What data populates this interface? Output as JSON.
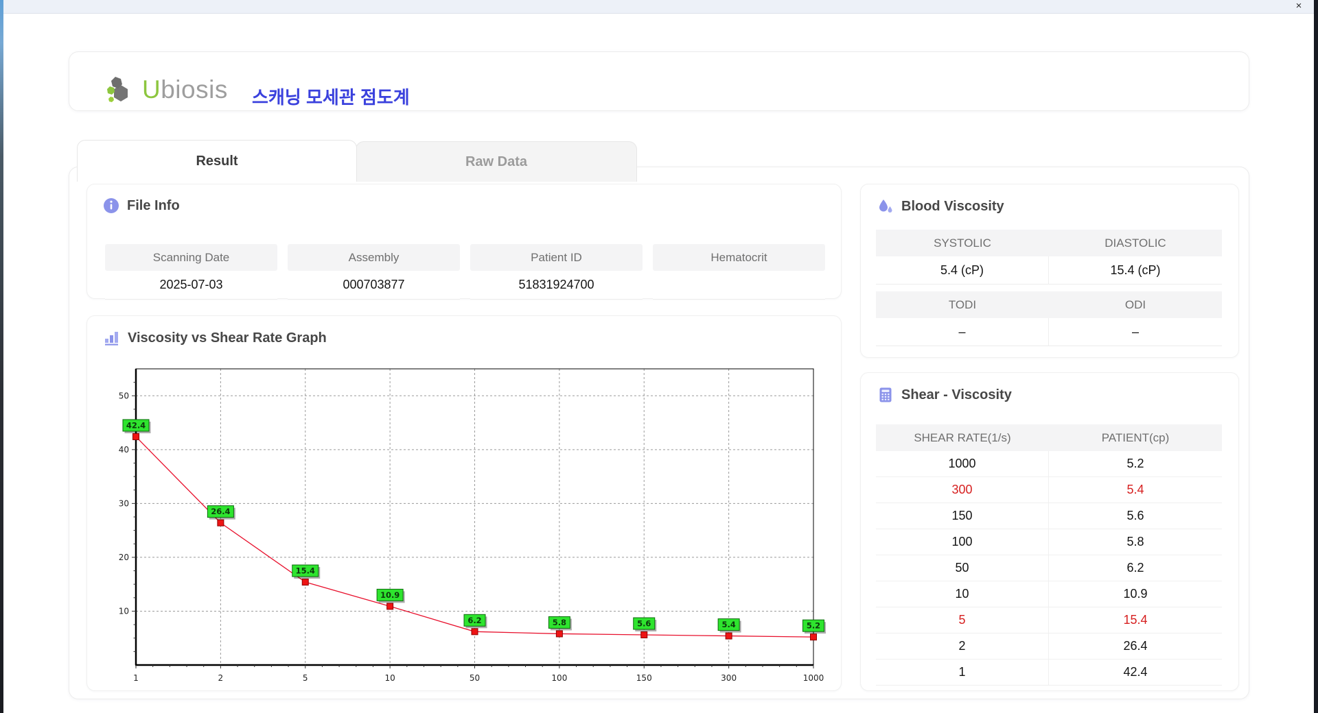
{
  "window": {
    "close_label": "×"
  },
  "header": {
    "brand_u": "U",
    "brand_rest": "biosis",
    "title": "스캐닝 모세관 점도계"
  },
  "tabs": [
    {
      "label": "Result",
      "active": true
    },
    {
      "label": "Raw Data",
      "active": false
    }
  ],
  "file_info": {
    "title": "File Info",
    "fields": [
      {
        "label": "Scanning Date",
        "value": "2025-07-03"
      },
      {
        "label": "Assembly",
        "value": "000703877"
      },
      {
        "label": "Patient ID",
        "value": "51831924700"
      },
      {
        "label": "Hematocrit",
        "value": ""
      }
    ]
  },
  "blood_viscosity": {
    "title": "Blood Viscosity",
    "pairs": [
      {
        "label_a": "SYSTOLIC",
        "value_a": "5.4 (cP)",
        "label_b": "DIASTOLIC",
        "value_b": "15.4 (cP)"
      },
      {
        "label_a": "TODI",
        "value_a": "–",
        "label_b": "ODI",
        "value_b": "–"
      }
    ]
  },
  "shear_viscosity": {
    "title": "Shear - Viscosity",
    "columns": [
      "SHEAR RATE(1/s)",
      "PATIENT(cp)"
    ],
    "rows": [
      {
        "shear": "1000",
        "patient": "5.2",
        "highlight": false
      },
      {
        "shear": "300",
        "patient": "5.4",
        "highlight": true
      },
      {
        "shear": "150",
        "patient": "5.6",
        "highlight": false
      },
      {
        "shear": "100",
        "patient": "5.8",
        "highlight": false
      },
      {
        "shear": "50",
        "patient": "6.2",
        "highlight": false
      },
      {
        "shear": "10",
        "patient": "10.9",
        "highlight": false
      },
      {
        "shear": "5",
        "patient": "15.4",
        "highlight": true
      },
      {
        "shear": "2",
        "patient": "26.4",
        "highlight": false
      },
      {
        "shear": "1",
        "patient": "42.4",
        "highlight": false
      }
    ],
    "highlight_color": "#d61f1f"
  },
  "graph_section": {
    "title": "Viscosity vs Shear Rate Graph"
  },
  "chart_data": {
    "type": "line",
    "categories": [
      "1",
      "2",
      "5",
      "10",
      "50",
      "100",
      "150",
      "300",
      "1000"
    ],
    "values": [
      42.4,
      26.4,
      15.4,
      10.9,
      6.2,
      5.8,
      5.6,
      5.4,
      5.2
    ],
    "title": "Viscosity vs Shear Rate Graph",
    "xlabel": "",
    "ylabel": "",
    "ylim": [
      0,
      55
    ],
    "yticks": [
      10,
      20,
      30,
      40,
      50
    ],
    "grid": true,
    "x_spacing": "categorical-even",
    "line_color": "#e8112d",
    "marker_color": "#ee1414",
    "marker_edge": "#8f0000",
    "label_bg": "#2ee42e",
    "label_edge": "#0c6b0c"
  },
  "accent_colors": {
    "icon_purple": "#8b93ea",
    "title_blue": "#3a41dd",
    "brand_green": "#8dc63f"
  }
}
